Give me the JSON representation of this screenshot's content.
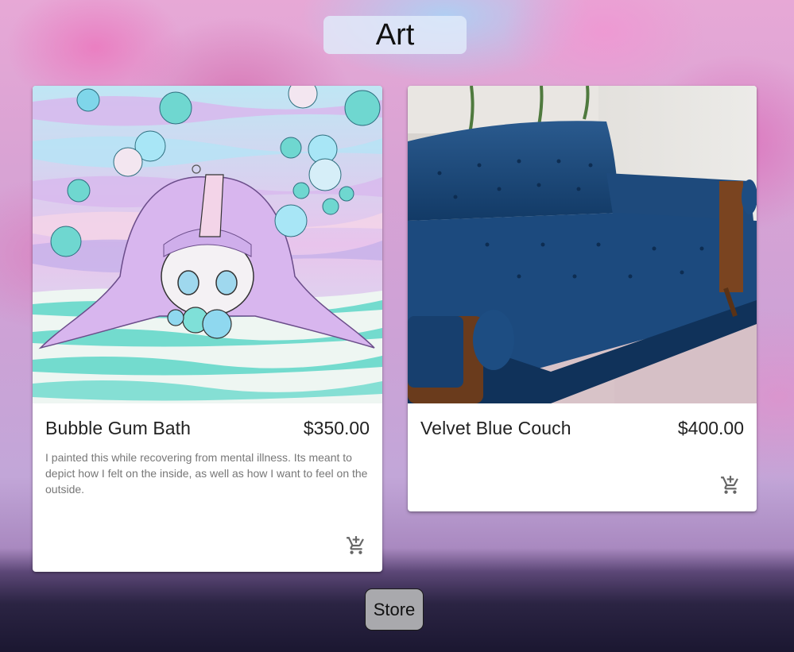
{
  "header": {
    "title": "Art"
  },
  "products": [
    {
      "name": "Bubble Gum Bath",
      "price": "$350.00",
      "description": "I painted this while recovering from mental illness. Its meant to depict how I felt on the inside, as well as how I want to feel on the outside.",
      "image": "painting of a lavender-haired girl submerged in bubble bath water",
      "cart_icon": "add-shopping-cart-icon"
    },
    {
      "name": "Velvet Blue Couch",
      "price": "$400.00",
      "description": "",
      "image": "photo of a tufted navy velvet couch with wooden arms",
      "cart_icon": "add-shopping-cart-icon"
    }
  ],
  "footer": {
    "store_label": "Store"
  },
  "colors": {
    "card_bg": "#ffffff",
    "button_bg": "#a9a9ad",
    "title_bg": "#e1ecfa"
  }
}
